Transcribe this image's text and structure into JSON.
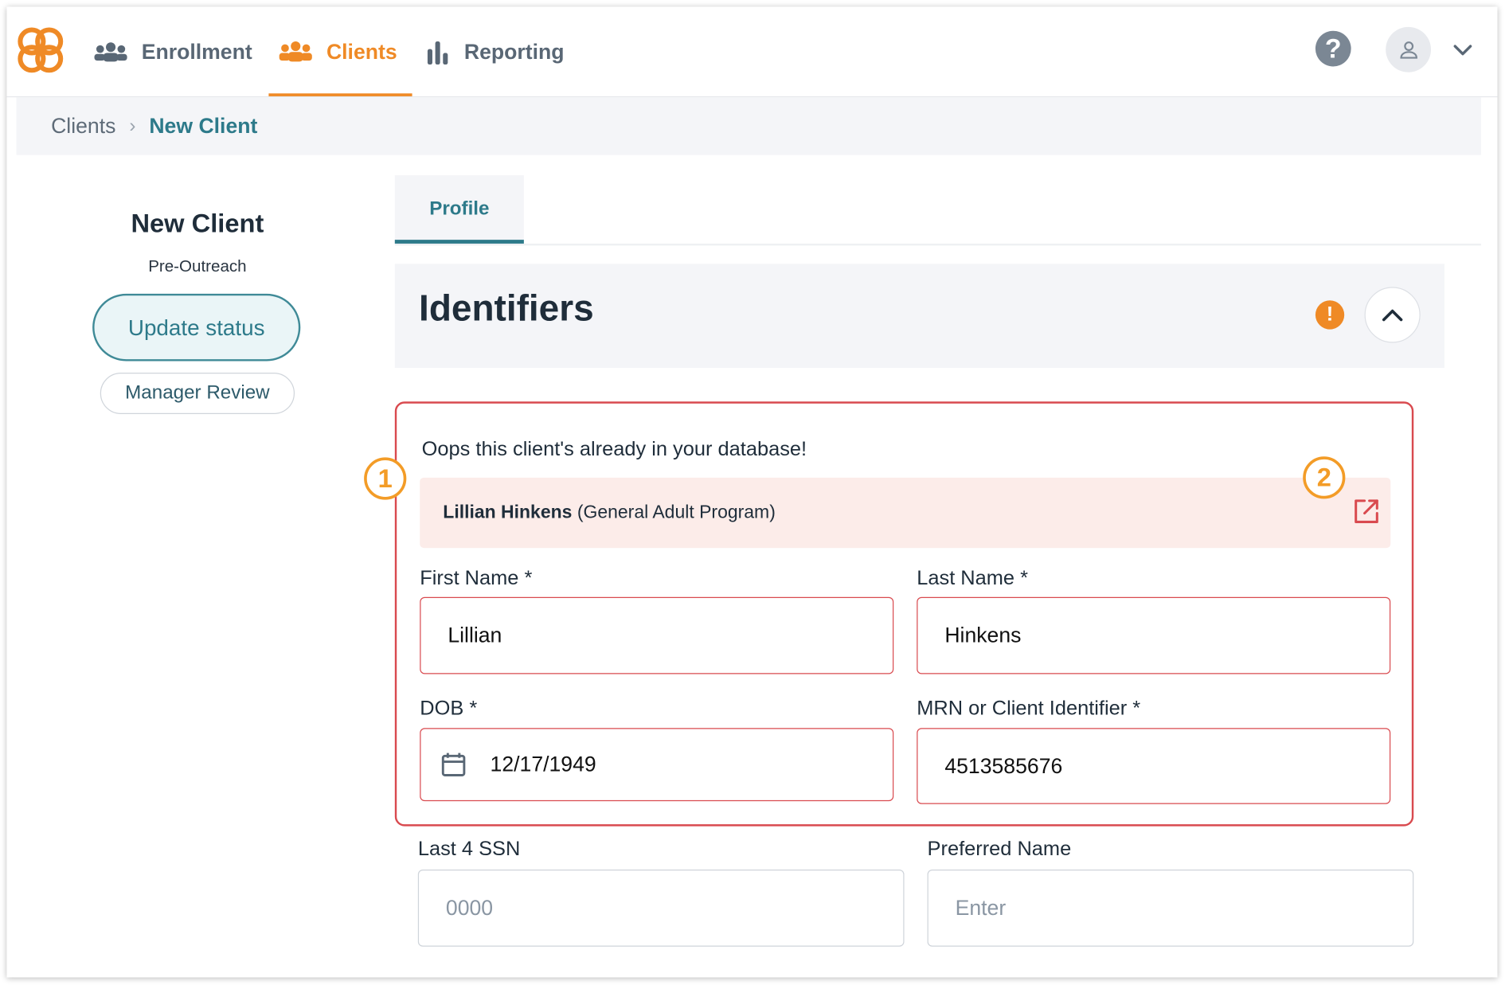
{
  "nav": {
    "items": [
      {
        "label": "Enrollment",
        "icon": "people-icon"
      },
      {
        "label": "Clients",
        "icon": "clients-icon",
        "active": true
      },
      {
        "label": "Reporting",
        "icon": "bar-chart-icon"
      }
    ]
  },
  "breadcrumb": {
    "root": "Clients",
    "current": "New Client"
  },
  "client": {
    "name": "New Client",
    "status": "Pre-Outreach",
    "update_status_label": "Update status",
    "manager_review_label": "Manager Review"
  },
  "tabs": [
    {
      "label": "Profile",
      "active": true
    }
  ],
  "section": {
    "title": "Identifiers"
  },
  "duplicate": {
    "message": "Oops this client's already in your database!",
    "match_name": "Lillian Hinkens",
    "match_program": "(General Adult Program)"
  },
  "form": {
    "first_name": {
      "label": "First Name *",
      "value": "Lillian"
    },
    "last_name": {
      "label": "Last Name *",
      "value": "Hinkens"
    },
    "dob": {
      "label": "DOB *",
      "value": "12/17/1949"
    },
    "mrn": {
      "label": "MRN or Client Identifier *",
      "value": "4513585676"
    },
    "ssn": {
      "label": "Last 4 SSN",
      "placeholder": "0000"
    },
    "preferred_name": {
      "label": "Preferred Name",
      "placeholder": "Enter"
    }
  },
  "callouts": [
    "1",
    "2"
  ],
  "colors": {
    "brand_orange": "#ef8a26",
    "teal": "#2d7a8a",
    "error_red": "#d94a4f",
    "callout": "#f39c27"
  }
}
